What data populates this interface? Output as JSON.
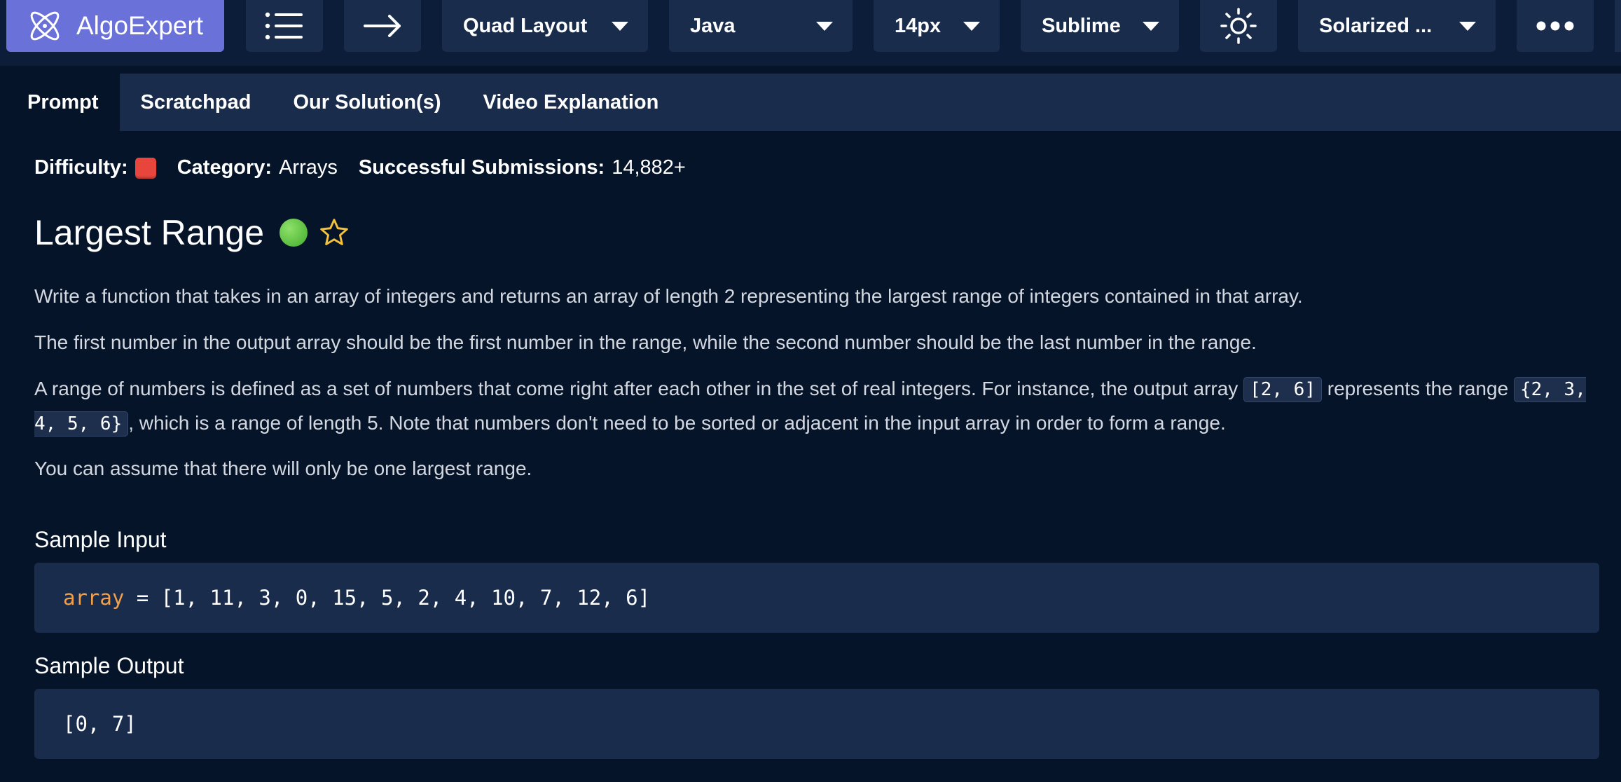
{
  "topbar": {
    "logo_text": "AlgoExpert",
    "layout_label": "Quad Layout",
    "language_label": "Java",
    "font_size_label": "14px",
    "keymap_label": "Sublime",
    "theme_label": "Solarized ...",
    "icons": {
      "logo": "algoexpert-logo-icon",
      "menu": "list-icon",
      "next": "arrow-right-icon",
      "theme_toggle": "sun-icon",
      "more": "ellipsis-icon",
      "dropdown": "caret-down-icon"
    }
  },
  "tabs": [
    {
      "label": "Prompt",
      "active": true
    },
    {
      "label": "Scratchpad",
      "active": false
    },
    {
      "label": "Our Solution(s)",
      "active": false
    },
    {
      "label": "Video Explanation",
      "active": false
    }
  ],
  "meta": {
    "difficulty_label": "Difficulty:",
    "difficulty_color": "#e8453c",
    "category_label": "Category:",
    "category_value": "Arrays",
    "submissions_label": "Successful Submissions:",
    "submissions_value": "14,882+"
  },
  "question": {
    "title": "Largest Range",
    "status_color": "#4cc13a",
    "star_color": "#f3c13a",
    "p1": "Write a function that takes in an array of integers and returns an array of length 2 representing the largest range of integers contained in that array.",
    "p2": "The first number in the output array should be the first number in the range, while the second number should be the last number in the range.",
    "p3_a": "A range of numbers is defined as a set of numbers that come right after each other in the set of real integers. For instance, the output array ",
    "p3_code1": "[2, 6]",
    "p3_b": " represents the range ",
    "p3_code2": "{2, 3, 4, 5, 6}",
    "p3_c": ", which is a range of length 5. Note that numbers don't need to be sorted or adjacent in the input array in order to form a range.",
    "p4": "You can assume that there will only be one largest range."
  },
  "sample_input": {
    "title": "Sample Input",
    "var_name": "array",
    "rest": " = [1, 11, 3, 0, 15, 5, 2, 4, 10, 7, 12, 6]"
  },
  "sample_output": {
    "title": "Sample Output",
    "value": "[0, 7]"
  }
}
